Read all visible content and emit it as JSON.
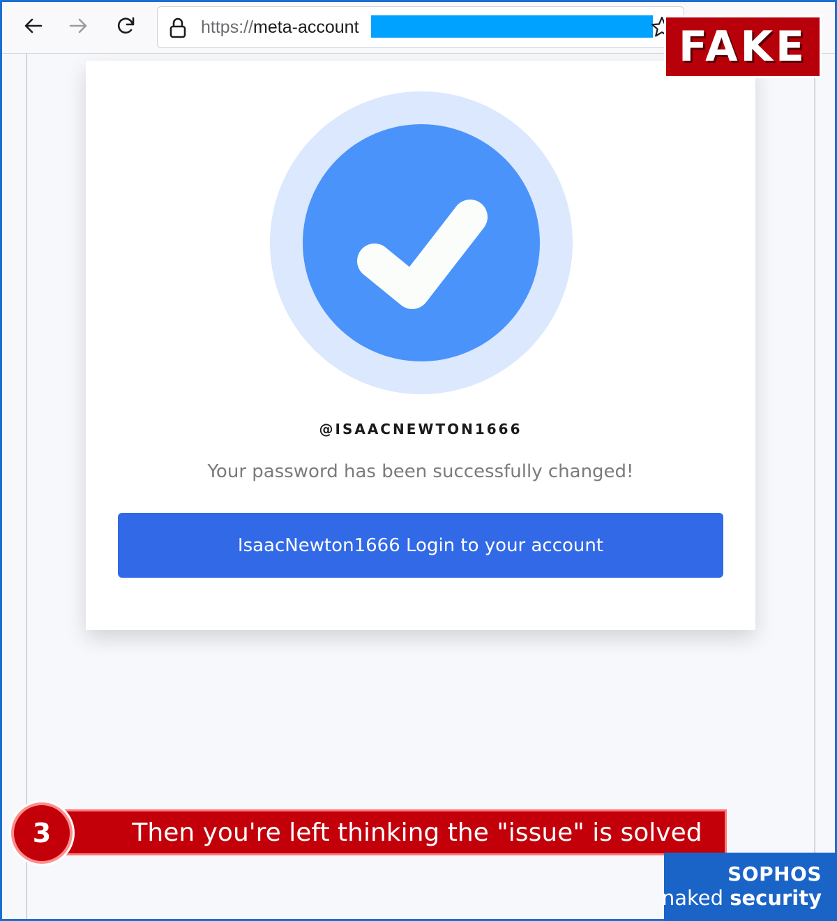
{
  "browser": {
    "url_scheme": "https://",
    "url_host_visible": "meta-account",
    "url_redacted": true,
    "icons": [
      "back-arrow-icon",
      "forward-arrow-icon",
      "reload-icon",
      "lock-icon",
      "bookmark-star-icon"
    ]
  },
  "stamp": {
    "label": "FAKE",
    "color": "#b8000b"
  },
  "card": {
    "badge_icon": "verified-check-icon",
    "badge_colors": {
      "outer": "#dbe8fd",
      "inner": "#4a93fb",
      "check": "#fbfdfa"
    },
    "handle": "@ISAACNEWTON1666",
    "message": "Your password has been successfully changed!",
    "login_button": "IsaacNewton1666 Login to your account",
    "button_color": "#3169e6"
  },
  "caption": {
    "step": "3",
    "text": "Then you're left thinking the \"issue\" is solved",
    "color": "#c3000a"
  },
  "brand": {
    "name": "SOPHOS",
    "tagline_light": "naked ",
    "tagline_bold": "security",
    "color": "#1a64c8"
  }
}
